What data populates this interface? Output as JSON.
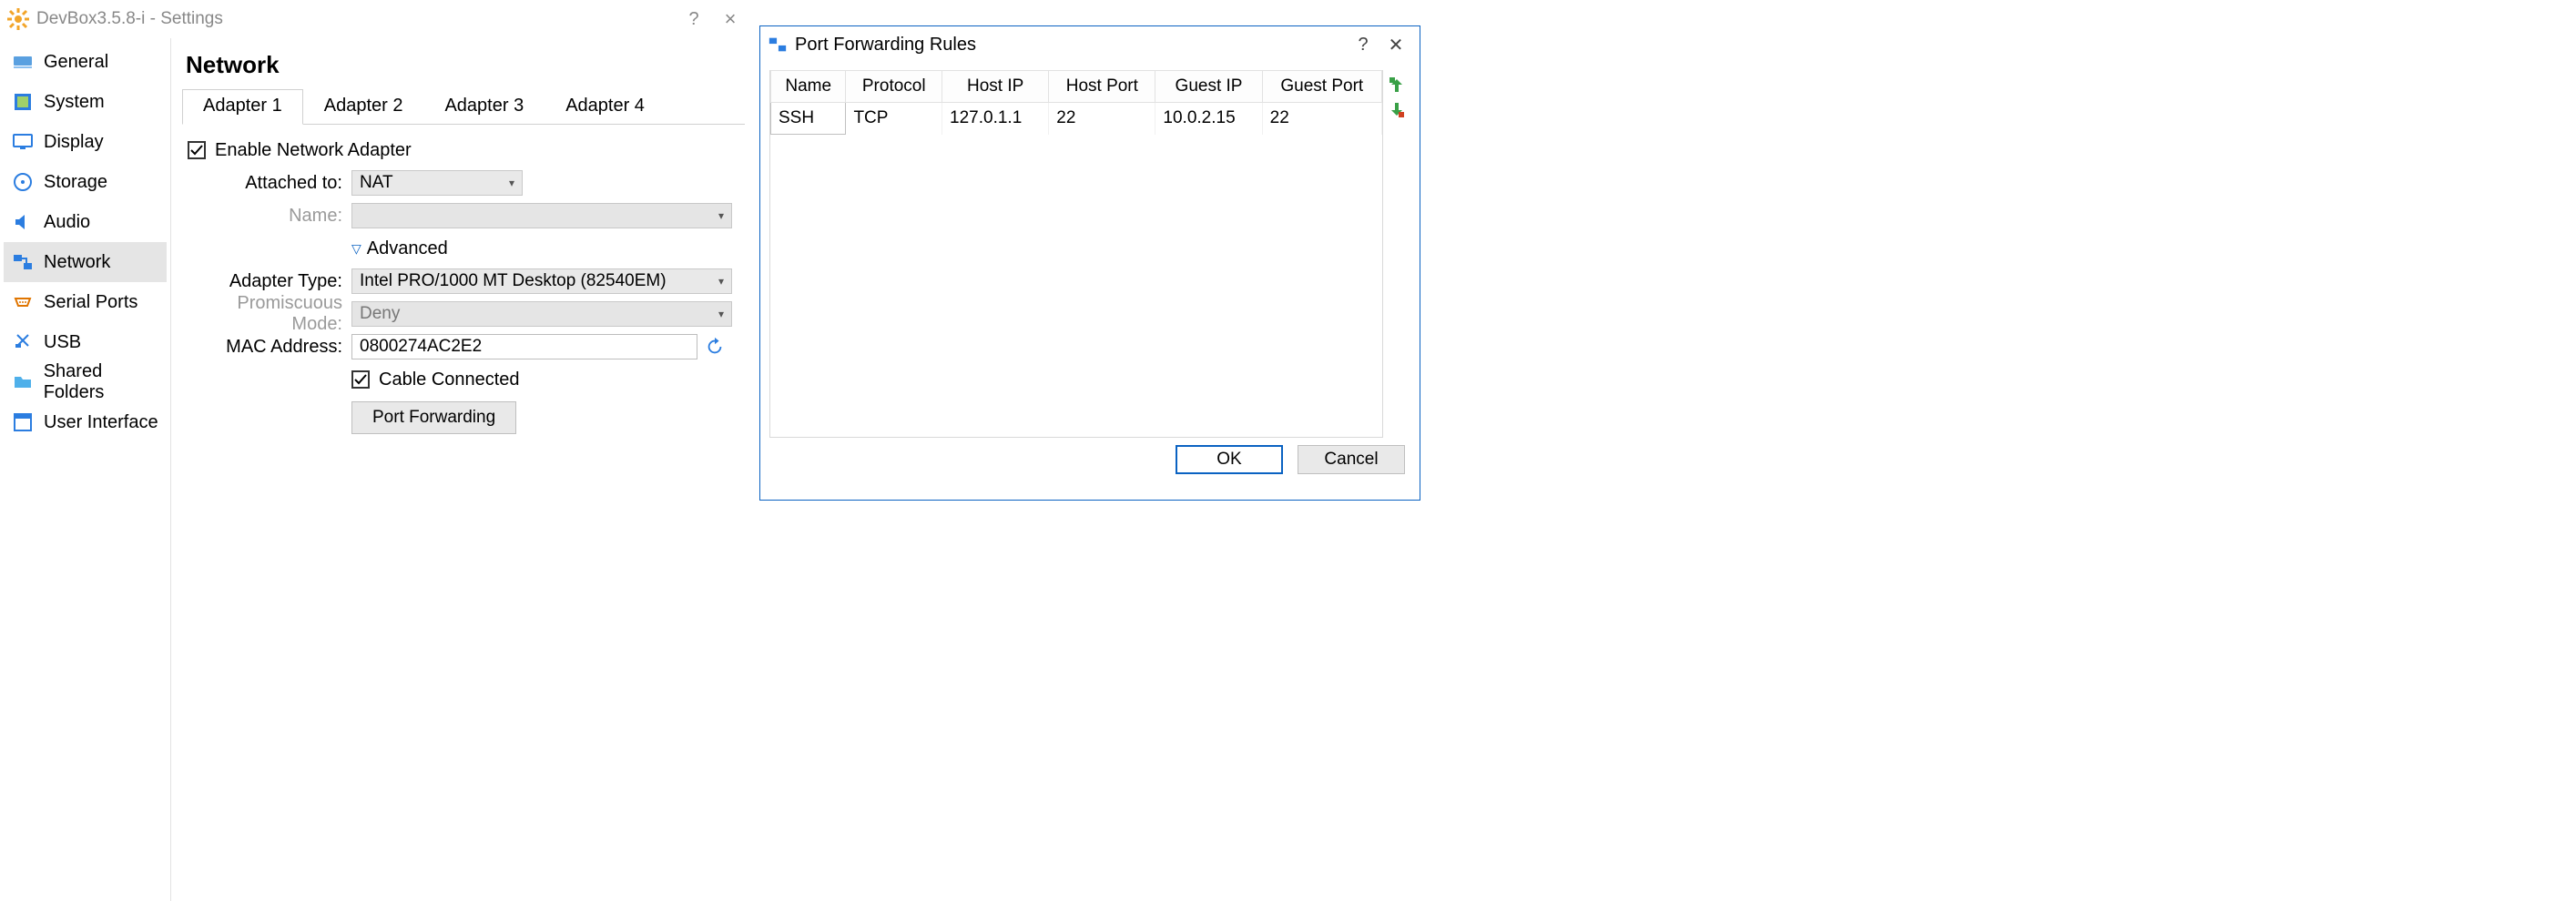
{
  "settings": {
    "window_title": "DevBox3.5.8-i - Settings",
    "page_title": "Network",
    "sidebar": [
      {
        "label": "General"
      },
      {
        "label": "System"
      },
      {
        "label": "Display"
      },
      {
        "label": "Storage"
      },
      {
        "label": "Audio"
      },
      {
        "label": "Network"
      },
      {
        "label": "Serial Ports"
      },
      {
        "label": "USB"
      },
      {
        "label": "Shared Folders"
      },
      {
        "label": "User Interface"
      }
    ],
    "tabs": [
      {
        "label": "Adapter 1"
      },
      {
        "label": "Adapter 2"
      },
      {
        "label": "Adapter 3"
      },
      {
        "label": "Adapter 4"
      }
    ],
    "enable_label": "Enable Network Adapter",
    "attached_to_label": "Attached to:",
    "attached_to_value": "NAT",
    "name_label": "Name:",
    "name_value": "",
    "advanced_label": "Advanced",
    "adapter_type_label": "Adapter Type:",
    "adapter_type_value": "Intel PRO/1000 MT Desktop (82540EM)",
    "promiscuous_label": "Promiscuous Mode:",
    "promiscuous_value": "Deny",
    "mac_label": "MAC Address:",
    "mac_value": "0800274AC2E2",
    "cable_label": "Cable Connected",
    "pf_button": "Port Forwarding"
  },
  "pf": {
    "title": "Port Forwarding Rules",
    "headers": [
      "Name",
      "Protocol",
      "Host IP",
      "Host Port",
      "Guest IP",
      "Guest Port"
    ],
    "rows": [
      {
        "name": "SSH",
        "protocol": "TCP",
        "host_ip": "127.0.1.1",
        "host_port": "22",
        "guest_ip": "10.0.2.15",
        "guest_port": "22"
      }
    ],
    "ok": "OK",
    "cancel": "Cancel"
  }
}
